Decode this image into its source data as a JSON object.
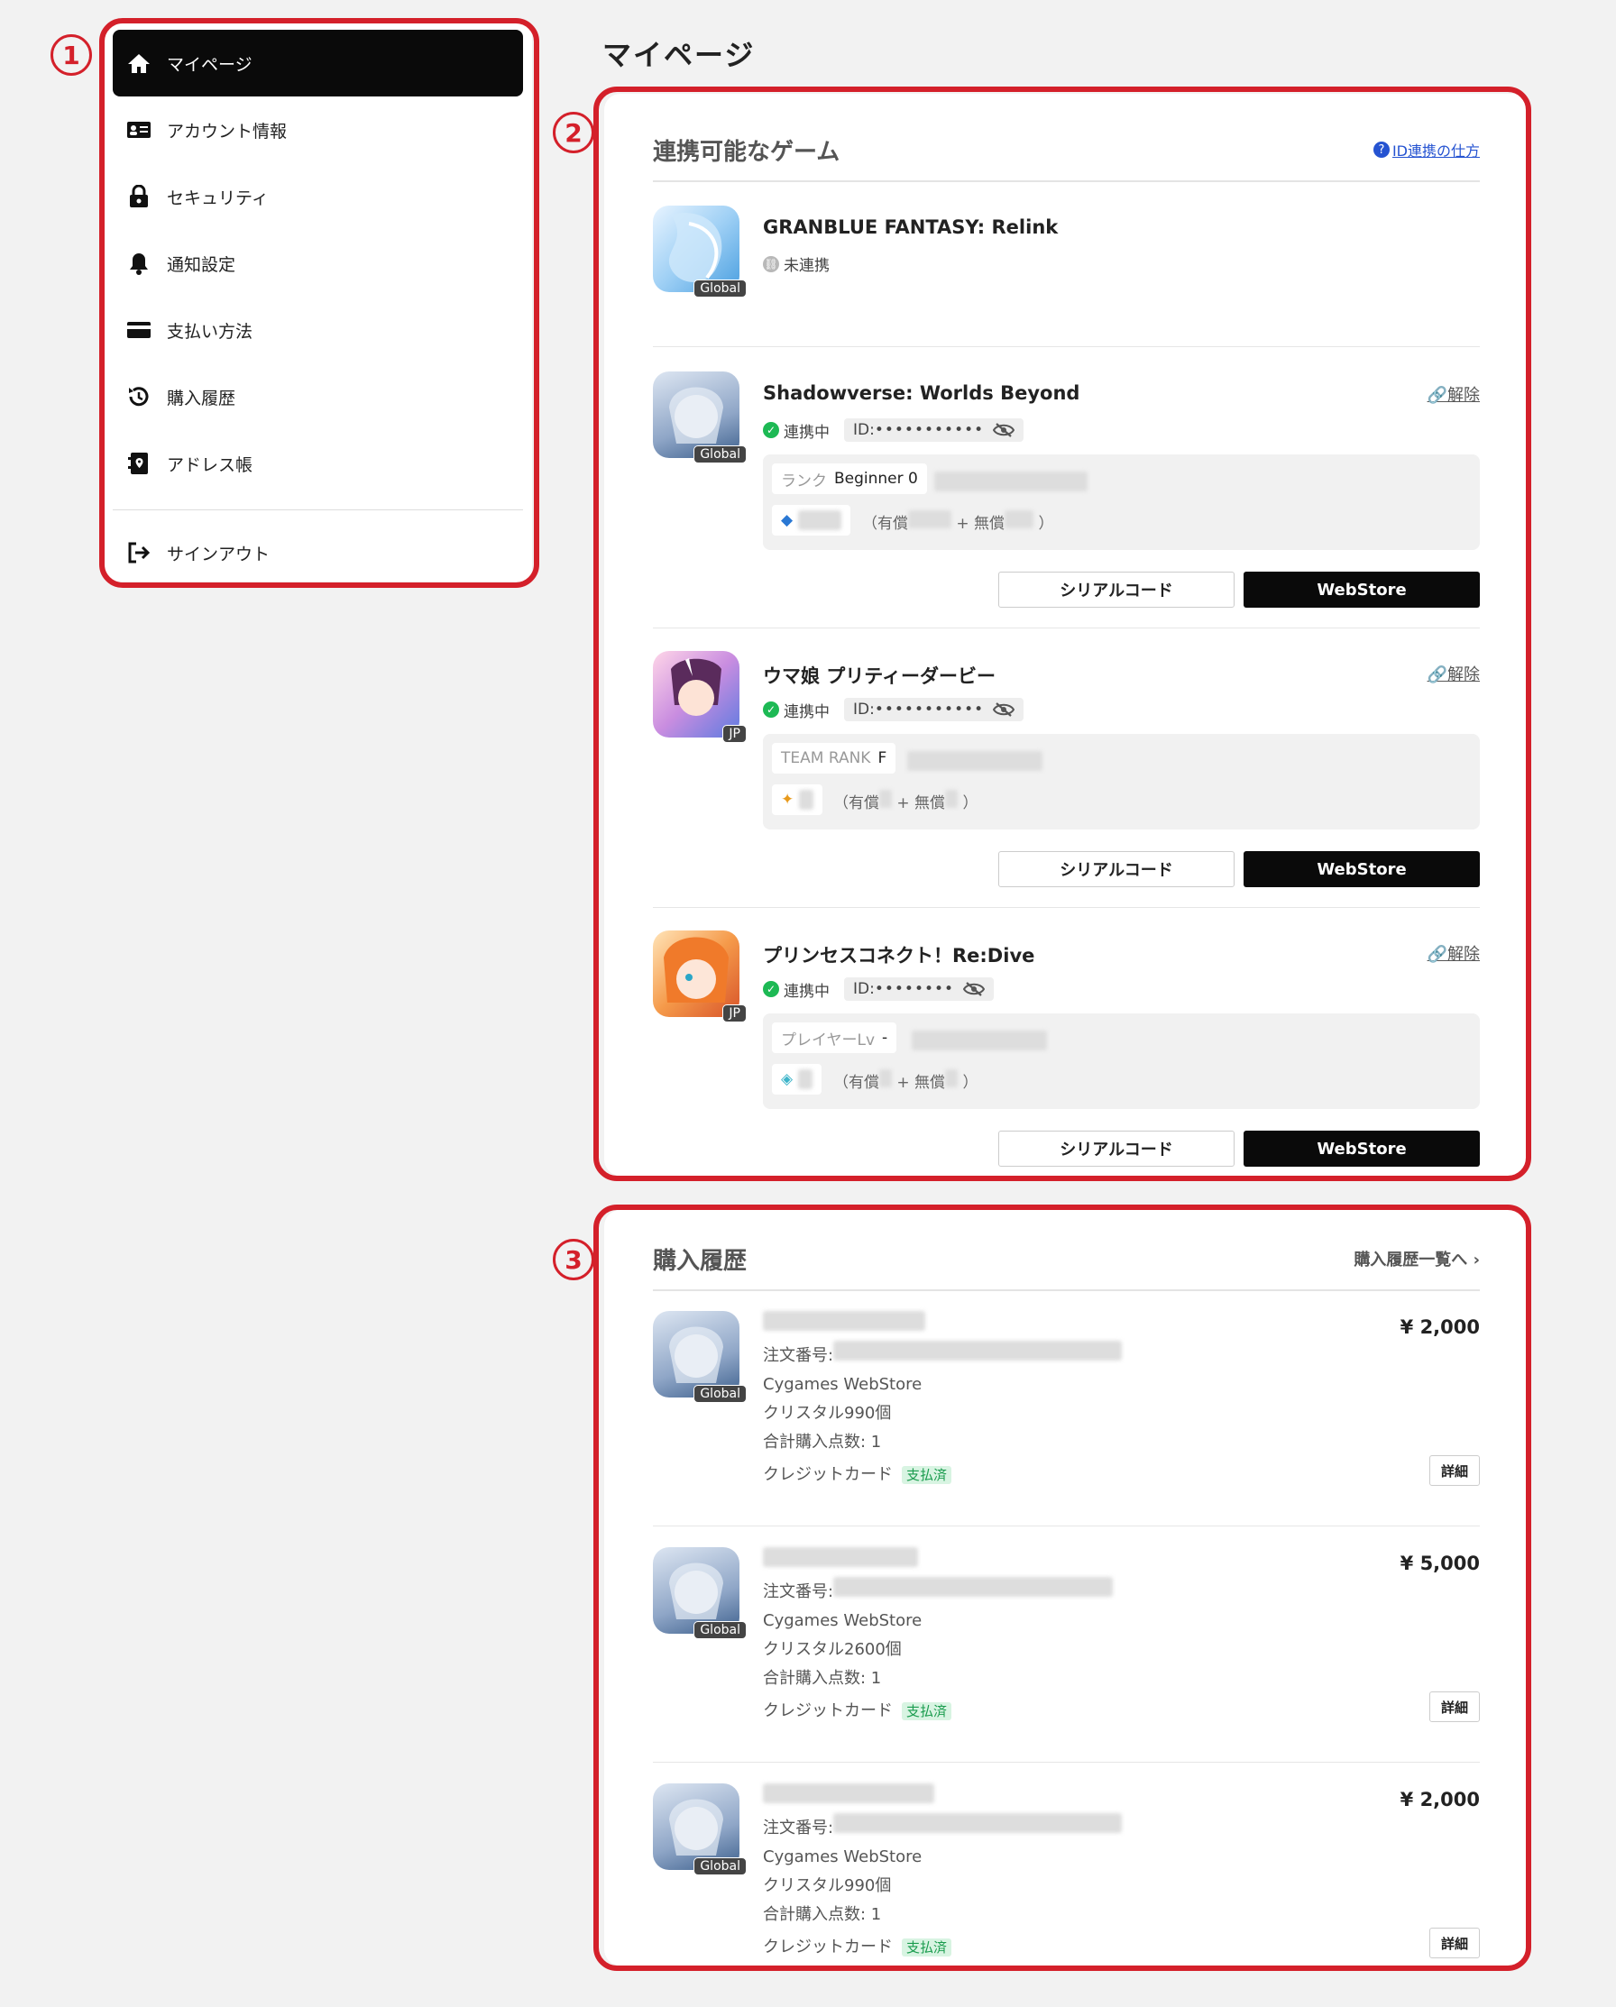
{
  "markers": [
    "1",
    "2",
    "3"
  ],
  "sidebar": {
    "items": [
      {
        "label": "マイページ",
        "icon": "home-icon"
      },
      {
        "label": "アカウント情報",
        "icon": "id-card-icon"
      },
      {
        "label": "セキュリティ",
        "icon": "lock-icon"
      },
      {
        "label": "通知設定",
        "icon": "bell-icon"
      },
      {
        "label": "支払い方法",
        "icon": "credit-card-icon"
      },
      {
        "label": "購入履歴",
        "icon": "history-icon"
      },
      {
        "label": "アドレス帳",
        "icon": "address-book-icon"
      }
    ],
    "signout": "サインアウト"
  },
  "page_title": "マイページ",
  "games_card": {
    "title": "連携可能なゲーム",
    "help_q": "?",
    "help_link": "ID連携の仕方",
    "unlink_label": "解除",
    "serial_label": "シリアルコード",
    "webstore_label": "WebStore",
    "id_prefix": "ID:",
    "paid_open": "（有償",
    "plus_free": "+ 無償",
    "close_paren": "）",
    "games": [
      {
        "name": "GRANBLUE FANTASY: Relink",
        "region": "Global",
        "status": "未連携",
        "linked": false
      },
      {
        "name": "Shadowverse: Worlds Beyond",
        "region": "Global",
        "status": "連携中",
        "linked": true,
        "id_mask": "•••••••••••",
        "rank_label": "ランク",
        "rank_value": "Beginner 0"
      },
      {
        "name": "ウマ娘 プリティーダービー",
        "region": "JP",
        "status": "連携中",
        "linked": true,
        "id_mask": "•••••••••••",
        "rank_label": "TEAM RANK",
        "rank_value": "F"
      },
      {
        "name": "プリンセスコネクト！Re:Dive",
        "region": "JP",
        "status": "連携中",
        "linked": true,
        "id_mask": "••••••••",
        "rank_label": "プレイヤーLv",
        "rank_value": "-"
      }
    ]
  },
  "purchase_card": {
    "title": "購入履歴",
    "more_link": "購入履歴一覧へ ›",
    "order_label": "注文番号:",
    "detail_label": "詳細",
    "paid_label": "支払済",
    "region": "Global",
    "items": [
      {
        "price": "¥ 2,000",
        "store": "Cygames WebStore",
        "product": "クリスタル990個",
        "count": "合計購入点数: 1",
        "payment": "クレジットカード"
      },
      {
        "price": "¥ 5,000",
        "store": "Cygames WebStore",
        "product": "クリスタル2600個",
        "count": "合計購入点数: 1",
        "payment": "クレジットカード"
      },
      {
        "price": "¥ 2,000",
        "store": "Cygames WebStore",
        "product": "クリスタル990個",
        "count": "合計購入点数: 1",
        "payment": "クレジットカード"
      }
    ]
  },
  "colors": {
    "frame": "#d4202a",
    "linked": "#1db954",
    "unlinked": "#b8b8b8",
    "link_blue": "#2553d1"
  }
}
